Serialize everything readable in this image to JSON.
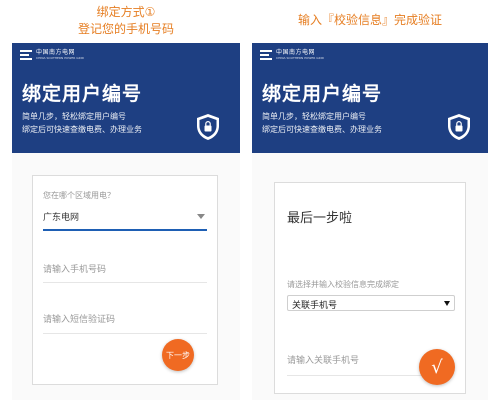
{
  "captions": {
    "left_line1": "绑定方式①",
    "left_line2": "登记您的手机号码",
    "right": "输入『校验信息』完成验证"
  },
  "brand": {
    "name": "中国南方电网",
    "sub": "CHINA SOUTHERN POWER GRID"
  },
  "hero": {
    "title": "绑定用户编号",
    "line1": "简单几步，轻松绑定用户编号",
    "line2": "绑定后可快速查缴电费、办理业务",
    "shield_icon": "shield-lock-icon"
  },
  "form1": {
    "region_hint": "您在哪个区域用电？",
    "region_value": "广东电网",
    "phone_placeholder": "请输入手机号码",
    "sms_placeholder": "请输入短信验证码",
    "next_label": "下一步"
  },
  "form2": {
    "title": "最后一步啦",
    "hint": "请选择并输入校验信息完成绑定",
    "select_value": "关联手机号",
    "input_placeholder": "请输入关联手机号",
    "submit_label": "√"
  },
  "colors": {
    "hero_blue": "#1e3f82",
    "accent_orange": "#f06a22",
    "caption_orange": "#e67e22"
  }
}
